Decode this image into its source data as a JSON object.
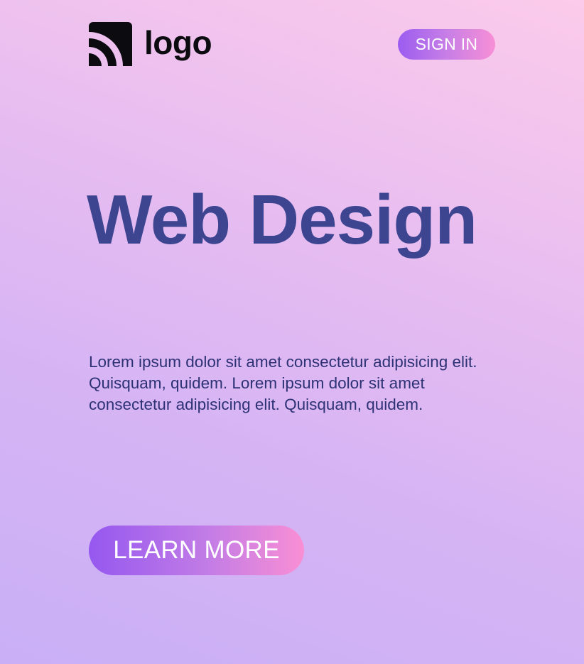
{
  "header": {
    "logo_text": "logo",
    "logo_icon": "rss-feed-icon",
    "signin_label": "SIGN IN"
  },
  "hero": {
    "title": "Web Design",
    "body": "Lorem ipsum dolor sit amet consectetur adipisicing elit. Quisquam, quidem. Lorem ipsum dolor sit amet consectetur adipisicing elit. Quisquam, quidem.",
    "cta_label": "LEARN MORE"
  },
  "colors": {
    "background_top": "#fccbeb",
    "background_bottom": "#c9aff6",
    "title": "#3d4591",
    "body_text": "#2d3275",
    "button_gradient_start": "#9558ef",
    "button_gradient_end": "#f98fd4"
  }
}
